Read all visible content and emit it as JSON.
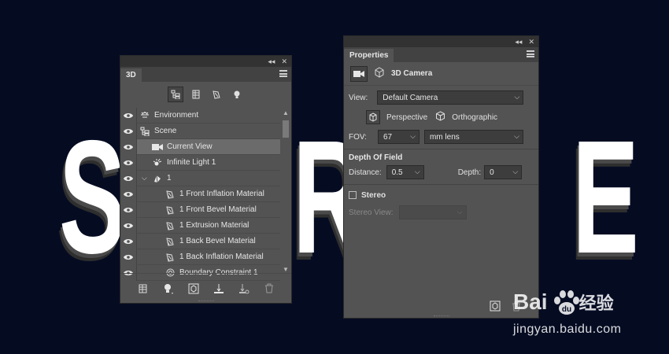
{
  "background": {
    "letters": [
      "S",
      "R",
      "E"
    ],
    "color": "#050c22"
  },
  "panel3d": {
    "tab_label": "3D",
    "collapse_glyph": "◂◂",
    "close_glyph": "✕",
    "filters": [
      {
        "icon": "scene-filter-icon",
        "active": true
      },
      {
        "icon": "mesh-filter-icon",
        "active": false
      },
      {
        "icon": "material-filter-icon",
        "active": false
      },
      {
        "icon": "light-filter-icon",
        "active": false
      }
    ],
    "rows": [
      {
        "label": "Environment",
        "icon": "environment-icon",
        "indent": 0,
        "selected": false
      },
      {
        "label": "Scene",
        "icon": "scene-icon",
        "indent": 0,
        "selected": false
      },
      {
        "label": "Current View",
        "icon": "camera-icon",
        "indent": 1,
        "selected": true
      },
      {
        "label": "Infinite Light 1",
        "icon": "light-icon",
        "indent": 1,
        "selected": false
      },
      {
        "label": "1",
        "icon": "mesh-icon",
        "indent": 1,
        "selected": false,
        "expanded": true
      },
      {
        "label": "1 Front Inflation Material",
        "icon": "material-icon",
        "indent": 2,
        "selected": false
      },
      {
        "label": "1 Front Bevel Material",
        "icon": "material-icon",
        "indent": 2,
        "selected": false
      },
      {
        "label": "1 Extrusion Material",
        "icon": "material-icon",
        "indent": 2,
        "selected": false
      },
      {
        "label": "1 Back Bevel Material",
        "icon": "material-icon",
        "indent": 2,
        "selected": false
      },
      {
        "label": "1 Back Inflation Material",
        "icon": "material-icon",
        "indent": 2,
        "selected": false
      },
      {
        "label": "Boundary Constraint 1",
        "icon": "constraint-icon",
        "indent": 2,
        "selected": false
      }
    ]
  },
  "properties": {
    "tab_label": "Properties",
    "collapse_glyph": "◂◂",
    "close_glyph": "✕",
    "title": "3D Camera",
    "view_label": "View:",
    "view_value": "Default Camera",
    "perspective_label": "Perspective",
    "orthographic_label": "Orthographic",
    "fov_label": "FOV:",
    "fov_value": "67",
    "fov_unit": "mm lens",
    "dof_title": "Depth Of Field",
    "distance_label": "Distance:",
    "distance_value": "0.5",
    "depth_label": "Depth:",
    "depth_value": "0",
    "stereo_label": "Stereo",
    "stereo_checked": false,
    "stereo_view_label": "Stereo View:",
    "stereo_view_value": ""
  },
  "watermark": {
    "brand_left": "Bai",
    "brand_right": "经验",
    "url": "jingyan.baidu.com"
  }
}
